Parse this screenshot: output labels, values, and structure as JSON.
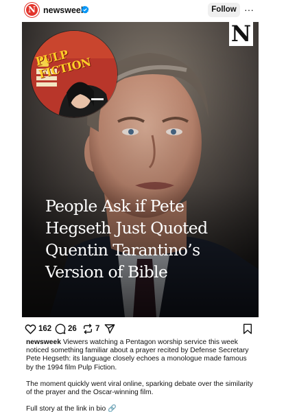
{
  "header": {
    "avatar_letter": "N",
    "username": "newsweek",
    "verified_icon": "verified-badge-icon",
    "follow_label": "Follow",
    "more_icon": "more-horizontal-icon",
    "more_glyph": "···"
  },
  "post": {
    "logo_letter": "N",
    "inset_title": "PULP FICTION",
    "headline_lines": [
      "People Ask if Pete",
      "Hegseth Just Quoted",
      "Quentin Tarantino’s",
      "Version of Bible"
    ]
  },
  "actions": {
    "like_count": "162",
    "comment_count": "26",
    "repost_count": "7",
    "like_icon": "heart-icon",
    "comment_icon": "comment-icon",
    "repost_icon": "repost-icon",
    "share_icon": "send-icon",
    "save_icon": "bookmark-icon"
  },
  "caption": {
    "username": "newsweek",
    "paragraph1": " Viewers watching a Pentagon worship service this week noticed something familiar about a prayer recited by Defense Secretary Pete Hegseth: its language closely echoes a monologue made famous by the 1994 film Pulp Fiction.",
    "paragraph2": "The moment quickly went viral online, sparking debate over the similarity of the prayer and the Oscar-winning film.",
    "paragraph3": "Full story at the link in bio 🔗"
  },
  "colors": {
    "brand_red": "#e2342b",
    "verified_blue": "#0095f6",
    "follow_bg": "#efefef"
  }
}
